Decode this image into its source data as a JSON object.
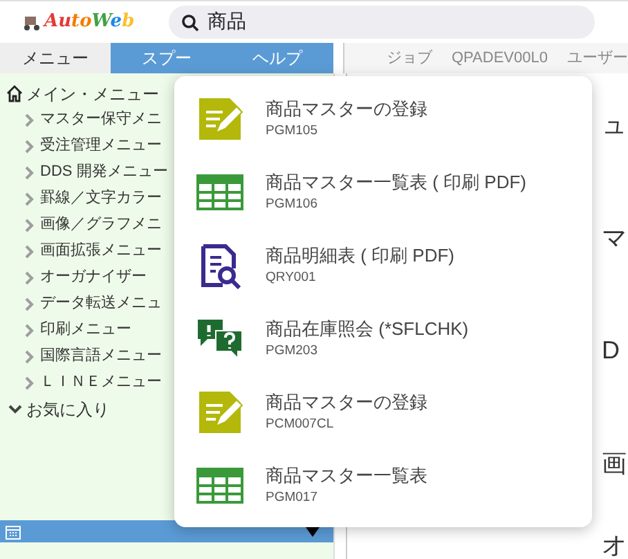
{
  "header": {
    "logo": "AutoWeb",
    "search": {
      "value": "商品"
    }
  },
  "tabs": [
    {
      "label": "メニュー",
      "selected": false
    },
    {
      "label": "スプー",
      "selected": true
    },
    {
      "label": "ヘルプ",
      "selected": true
    }
  ],
  "job_bar": [
    "ジョブ",
    "QPADEV00L0",
    "ユーザー"
  ],
  "sidebar": {
    "root": {
      "label": "メイン・メニュー",
      "children": [
        {
          "label": "マスター保守メニ"
        },
        {
          "label": "受注管理メニュー"
        },
        {
          "label": "DDS 開発メニュー"
        },
        {
          "label": "罫線／文字カラー"
        },
        {
          "label": "画像／グラフメニ"
        },
        {
          "label": "画面拡張メニュー"
        },
        {
          "label": "オーガナイザー"
        },
        {
          "label": "データ転送メニュ"
        },
        {
          "label": "印刷メニュー"
        },
        {
          "label": "国際言語メニュー"
        },
        {
          "label": "ＬＩＮＥメニュー"
        }
      ]
    },
    "favorites": {
      "label": "お気に入り",
      "expanded": true
    }
  },
  "content_fragments": [
    "ュ",
    "マ",
    "D",
    "画",
    "オ"
  ],
  "results": [
    {
      "kind": "edit",
      "title": "商品マスターの登録",
      "code": "PGM105"
    },
    {
      "kind": "table",
      "title": "商品マスター一覧表 ( 印刷 PDF)",
      "code": "PGM106"
    },
    {
      "kind": "inspect",
      "title": "商品明細表 ( 印刷 PDF)",
      "code": "QRY001"
    },
    {
      "kind": "chat",
      "title": "商品在庫照会 (*SFLCHK)",
      "code": "PGM203"
    },
    {
      "kind": "edit",
      "title": "商品マスターの登録",
      "code": "PCM007CL"
    },
    {
      "kind": "table",
      "title": "商品マスター一覧表",
      "code": "PGM017"
    }
  ]
}
